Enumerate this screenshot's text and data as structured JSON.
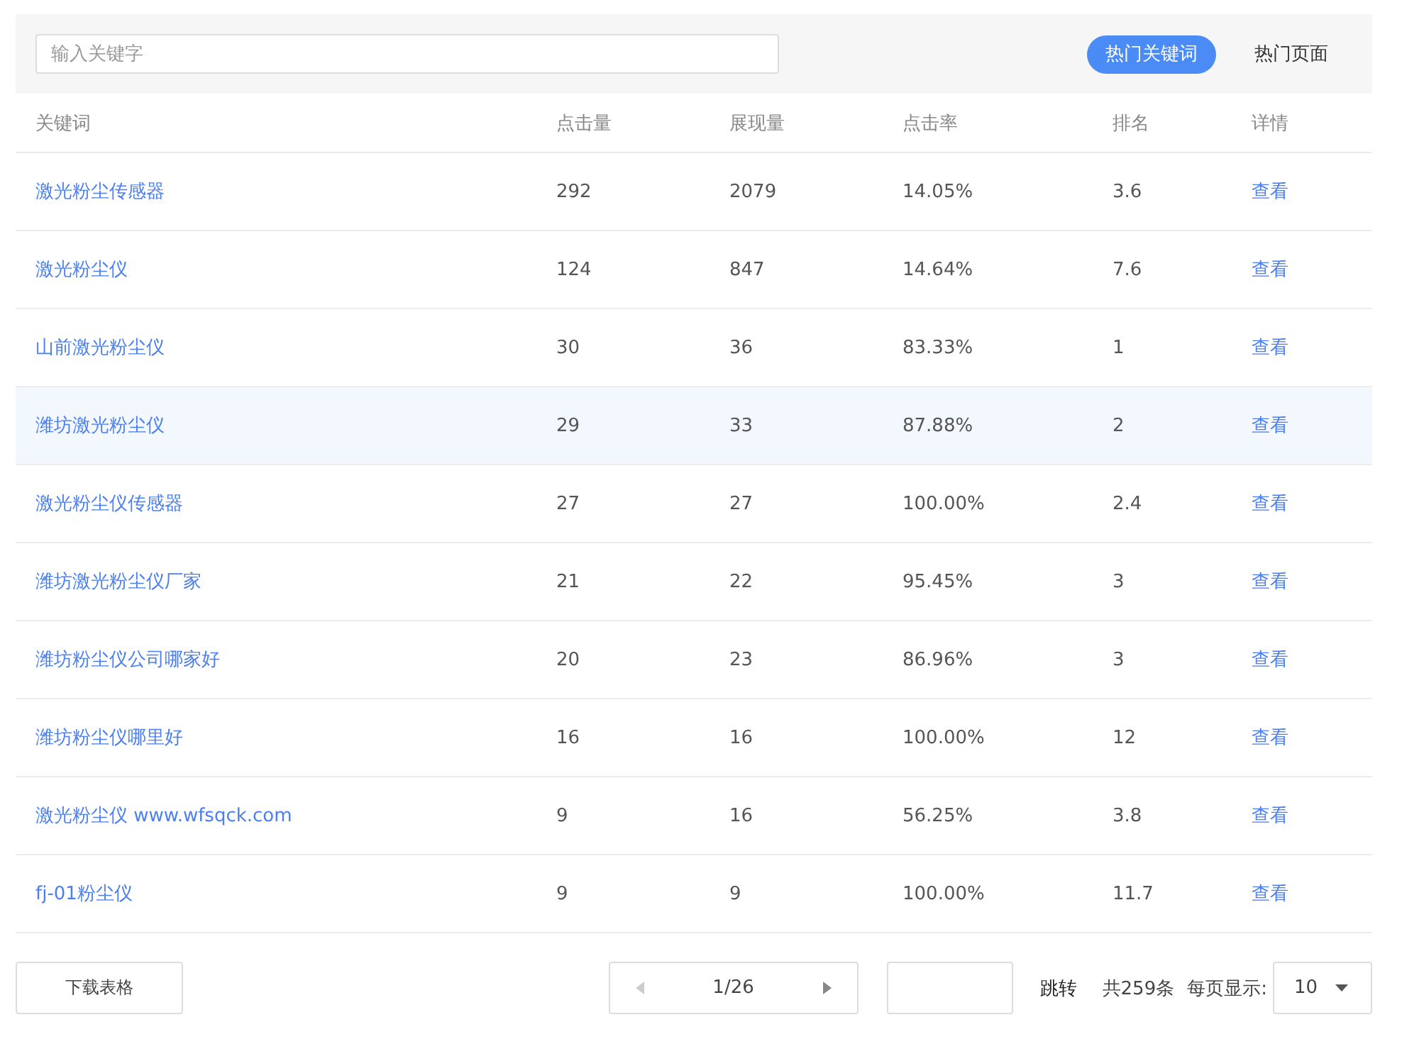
{
  "search": {
    "placeholder": "输入关键字"
  },
  "tabs": [
    {
      "label": "热门关键词",
      "selected": true
    },
    {
      "label": "热门页面",
      "selected": false
    }
  ],
  "table": {
    "columns": [
      "关键词",
      "点击量",
      "展现量",
      "点击率",
      "排名",
      "详情"
    ],
    "rows": [
      {
        "keyword": "激光粉尘传感器",
        "clicks": "292",
        "impressions": "2079",
        "ctr": "14.05%",
        "rank": "3.6",
        "detail": "查看",
        "highlighted": false
      },
      {
        "keyword": "激光粉尘仪",
        "clicks": "124",
        "impressions": "847",
        "ctr": "14.64%",
        "rank": "7.6",
        "detail": "查看",
        "highlighted": false
      },
      {
        "keyword": "山前激光粉尘仪",
        "clicks": "30",
        "impressions": "36",
        "ctr": "83.33%",
        "rank": "1",
        "detail": "查看",
        "highlighted": false
      },
      {
        "keyword": "潍坊激光粉尘仪",
        "clicks": "29",
        "impressions": "33",
        "ctr": "87.88%",
        "rank": "2",
        "detail": "查看",
        "highlighted": true
      },
      {
        "keyword": "激光粉尘仪传感器",
        "clicks": "27",
        "impressions": "27",
        "ctr": "100.00%",
        "rank": "2.4",
        "detail": "查看",
        "highlighted": false
      },
      {
        "keyword": "潍坊激光粉尘仪厂家",
        "clicks": "21",
        "impressions": "22",
        "ctr": "95.45%",
        "rank": "3",
        "detail": "查看",
        "highlighted": false
      },
      {
        "keyword": "潍坊粉尘仪公司哪家好",
        "clicks": "20",
        "impressions": "23",
        "ctr": "86.96%",
        "rank": "3",
        "detail": "查看",
        "highlighted": false
      },
      {
        "keyword": "潍坊粉尘仪哪里好",
        "clicks": "16",
        "impressions": "16",
        "ctr": "100.00%",
        "rank": "12",
        "detail": "查看",
        "highlighted": false
      },
      {
        "keyword": "激光粉尘仪 www.wfsqck.com",
        "clicks": "9",
        "impressions": "16",
        "ctr": "56.25%",
        "rank": "3.8",
        "detail": "查看",
        "highlighted": false
      },
      {
        "keyword": "fj-01粉尘仪",
        "clicks": "9",
        "impressions": "9",
        "ctr": "100.00%",
        "rank": "11.7",
        "detail": "查看",
        "highlighted": false
      }
    ]
  },
  "footer": {
    "download": "下载表格",
    "pager": {
      "page": "1/26",
      "prev_disabled": true,
      "next_disabled": false
    },
    "jump": "跳转",
    "total": "共259条",
    "per_page_label": "每页显示:",
    "per_page": "10"
  }
}
